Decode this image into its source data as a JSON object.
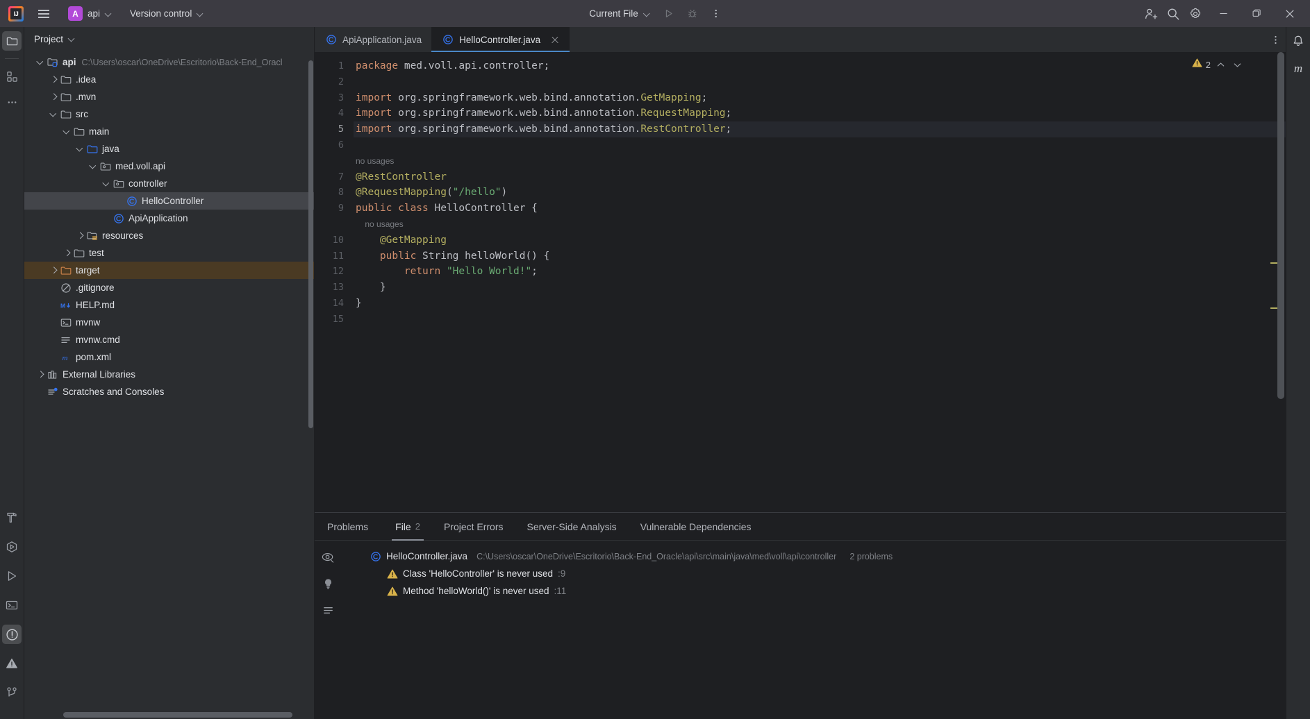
{
  "titlebar": {
    "logo_alt": "intellij-idea-logo",
    "menu_icon": "hamburger-menu-icon",
    "project_badge": "A",
    "project_name": "api",
    "version_control": "Version control",
    "run_config": "Current File",
    "run_icon": "run-icon",
    "debug_icon": "debug-icon",
    "more_icon": "more-vertical-icon",
    "code_with_me_icon": "add-user-icon",
    "search_icon": "search-icon",
    "settings_icon": "gear-icon",
    "minimize_icon": "minimize-icon",
    "maximize_icon": "maximize-icon",
    "close_icon": "close-icon"
  },
  "left_rail": {
    "top": [
      {
        "name": "project-tool-window",
        "icon": "folder-icon",
        "selected": true
      },
      {
        "name": "commit-tool-window",
        "icon": "squares-icon",
        "selected": false
      },
      {
        "name": "more-tool-windows",
        "icon": "ellipsis-icon",
        "selected": false
      }
    ],
    "bottom": [
      {
        "name": "build-tool-window",
        "icon": "hammer-icon",
        "selected": false
      },
      {
        "name": "services-tool-window",
        "icon": "services-play-icon",
        "selected": false
      },
      {
        "name": "run-tool-window",
        "icon": "play-icon",
        "selected": false
      },
      {
        "name": "terminal-tool-window",
        "icon": "terminal-icon",
        "selected": false
      },
      {
        "name": "problems-tool-window",
        "icon": "exclamation-circle-icon",
        "selected": true
      },
      {
        "name": "notifications-tool-window",
        "icon": "warning-triangle-icon",
        "selected": false
      },
      {
        "name": "version-control-tool-window",
        "icon": "git-branch-icon",
        "selected": false
      }
    ]
  },
  "right_rail": [
    {
      "name": "notifications",
      "icon": "bell-icon"
    },
    {
      "name": "maven-tool-window",
      "icon": "maven-m-icon",
      "label": "m"
    }
  ],
  "project": {
    "title": "Project",
    "tree": [
      {
        "depth": 0,
        "arrow": "open",
        "icon": "module-folder-icon",
        "label": "api",
        "bold": true,
        "path": "C:\\Users\\oscar\\OneDrive\\Escritorio\\Back-End_Oracl"
      },
      {
        "depth": 1,
        "arrow": "closed",
        "icon": "folder-icon",
        "label": ".idea"
      },
      {
        "depth": 1,
        "arrow": "closed",
        "icon": "folder-icon",
        "label": ".mvn"
      },
      {
        "depth": 1,
        "arrow": "open",
        "icon": "folder-icon",
        "label": "src"
      },
      {
        "depth": 2,
        "arrow": "open",
        "icon": "folder-icon",
        "label": "main"
      },
      {
        "depth": 3,
        "arrow": "open",
        "icon": "source-folder-icon",
        "label": "java"
      },
      {
        "depth": 4,
        "arrow": "open",
        "icon": "package-icon",
        "label": "med.voll.api"
      },
      {
        "depth": 5,
        "arrow": "open",
        "icon": "package-icon",
        "label": "controller"
      },
      {
        "depth": 6,
        "arrow": "none",
        "icon": "java-class-icon",
        "label": "HelloController",
        "selected": true
      },
      {
        "depth": 5,
        "arrow": "none",
        "icon": "java-class-icon",
        "label": "ApiApplication"
      },
      {
        "depth": 3,
        "arrow": "closed",
        "icon": "resources-folder-icon",
        "label": "resources"
      },
      {
        "depth": 2,
        "arrow": "closed",
        "icon": "folder-icon",
        "label": "test"
      },
      {
        "depth": 1,
        "arrow": "closed",
        "icon": "excluded-folder-icon",
        "label": "target",
        "excluded": true
      },
      {
        "depth": 1,
        "arrow": "none",
        "icon": "gitignore-icon",
        "label": ".gitignore"
      },
      {
        "depth": 1,
        "arrow": "none",
        "icon": "markdown-icon",
        "label": "HELP.md"
      },
      {
        "depth": 1,
        "arrow": "none",
        "icon": "shell-script-icon",
        "label": "mvnw"
      },
      {
        "depth": 1,
        "arrow": "none",
        "icon": "text-file-icon",
        "label": "mvnw.cmd"
      },
      {
        "depth": 1,
        "arrow": "none",
        "icon": "maven-m-icon",
        "label": "pom.xml"
      },
      {
        "depth": 0,
        "arrow": "closed",
        "icon": "library-icon",
        "label": "External Libraries"
      },
      {
        "depth": 0,
        "arrow": "none",
        "icon": "scratches-icon",
        "label": "Scratches and Consoles"
      }
    ]
  },
  "editor": {
    "tabs": [
      {
        "label": "ApiApplication.java",
        "icon": "java-class-icon",
        "active": false,
        "closable": false
      },
      {
        "label": "HelloController.java",
        "icon": "java-class-icon",
        "active": true,
        "closable": true
      }
    ],
    "tab_options_icon": "more-vertical-icon",
    "inspection": {
      "icon": "warning-triangle-icon",
      "count": "2",
      "up_icon": "chevron-up-icon",
      "down_icon": "chevron-down-icon"
    },
    "lines": [
      {
        "num": "1",
        "current": false,
        "tokens": [
          {
            "t": "kw",
            "v": "package"
          },
          {
            "t": "pl",
            "v": " med.voll.api.controller;"
          }
        ]
      },
      {
        "num": "2",
        "current": false,
        "tokens": []
      },
      {
        "num": "3",
        "current": false,
        "tokens": [
          {
            "t": "kw",
            "v": "import"
          },
          {
            "t": "pl",
            "v": " org.springframework.web.bind.annotation."
          },
          {
            "t": "ann",
            "v": "GetMapping"
          },
          {
            "t": "pl",
            "v": ";"
          }
        ]
      },
      {
        "num": "4",
        "current": false,
        "tokens": [
          {
            "t": "kw",
            "v": "import"
          },
          {
            "t": "pl",
            "v": " org.springframework.web.bind.annotation."
          },
          {
            "t": "ann",
            "v": "RequestMapping"
          },
          {
            "t": "pl",
            "v": ";"
          }
        ]
      },
      {
        "num": "5",
        "current": true,
        "tokens": [
          {
            "t": "kw",
            "v": "import"
          },
          {
            "t": "pl",
            "v": " org.springframework.web.bind.annotation."
          },
          {
            "t": "ann",
            "v": "RestController"
          },
          {
            "t": "pl",
            "v": ";"
          }
        ]
      },
      {
        "num": "6",
        "current": false,
        "tokens": []
      },
      {
        "num": "",
        "current": false,
        "hint": "no usages"
      },
      {
        "num": "7",
        "current": false,
        "tokens": [
          {
            "t": "ann",
            "v": "@RestController"
          }
        ]
      },
      {
        "num": "8",
        "current": false,
        "tokens": [
          {
            "t": "ann",
            "v": "@RequestMapping"
          },
          {
            "t": "pl",
            "v": "("
          },
          {
            "t": "str",
            "v": "\"/hello\""
          },
          {
            "t": "pl",
            "v": ")"
          }
        ]
      },
      {
        "num": "9",
        "current": false,
        "tokens": [
          {
            "t": "kw",
            "v": "public class"
          },
          {
            "t": "cls",
            "v": " HelloController"
          },
          {
            "t": "pl",
            "v": " {"
          }
        ]
      },
      {
        "num": "",
        "current": false,
        "hint": "    no usages"
      },
      {
        "num": "10",
        "current": false,
        "tokens": [
          {
            "t": "ann",
            "v": "    @GetMapping"
          }
        ]
      },
      {
        "num": "11",
        "current": false,
        "tokens": [
          {
            "t": "kw",
            "v": "    public "
          },
          {
            "t": "cls",
            "v": "String"
          },
          {
            "t": "mth",
            "v": " helloWorld"
          },
          {
            "t": "pl",
            "v": "() {"
          }
        ]
      },
      {
        "num": "12",
        "current": false,
        "tokens": [
          {
            "t": "kw",
            "v": "        return "
          },
          {
            "t": "str",
            "v": "\"Hello World!\""
          },
          {
            "t": "pl",
            "v": ";"
          }
        ]
      },
      {
        "num": "13",
        "current": false,
        "tokens": [
          {
            "t": "pl",
            "v": "    }"
          }
        ]
      },
      {
        "num": "14",
        "current": false,
        "tokens": [
          {
            "t": "pl",
            "v": "}"
          }
        ]
      },
      {
        "num": "15",
        "current": false,
        "tokens": []
      }
    ]
  },
  "problems": {
    "tabs": [
      {
        "label": "Problems",
        "badge": "",
        "active": false
      },
      {
        "label": "File",
        "badge": "2",
        "active": true
      },
      {
        "label": "Project Errors",
        "badge": "",
        "active": false
      },
      {
        "label": "Server-Side Analysis",
        "badge": "",
        "active": false
      },
      {
        "label": "Vulnerable Dependencies",
        "badge": "",
        "active": false
      }
    ],
    "side_icons": [
      {
        "name": "preview-eye-icon",
        "icon": "eye-icon"
      },
      {
        "name": "quick-fix-icon",
        "icon": "lightbulb-icon"
      },
      {
        "name": "group-by-icon",
        "icon": "list-icon"
      }
    ],
    "file": {
      "icon": "java-class-icon",
      "name": "HelloController.java",
      "path": "C:\\Users\\oscar\\OneDrive\\Escritorio\\Back-End_Oracle\\api\\src\\main\\java\\med\\voll\\api\\controller",
      "count": "2 problems"
    },
    "items": [
      {
        "icon": "warning-triangle-icon",
        "message": "Class 'HelloController' is never used",
        "line": ":9"
      },
      {
        "icon": "warning-triangle-icon",
        "message": "Method 'helloWorld()' is never used",
        "line": ":11"
      }
    ]
  },
  "colors": {
    "accent": "#4a88c7",
    "titlebar_bg": "#3c3b42",
    "panel_bg": "#2b2d30",
    "editor_bg": "#1e1f22",
    "warning": "#b3ae60",
    "excluded": "#4a3a23",
    "project_badge": "#b24ad8"
  }
}
